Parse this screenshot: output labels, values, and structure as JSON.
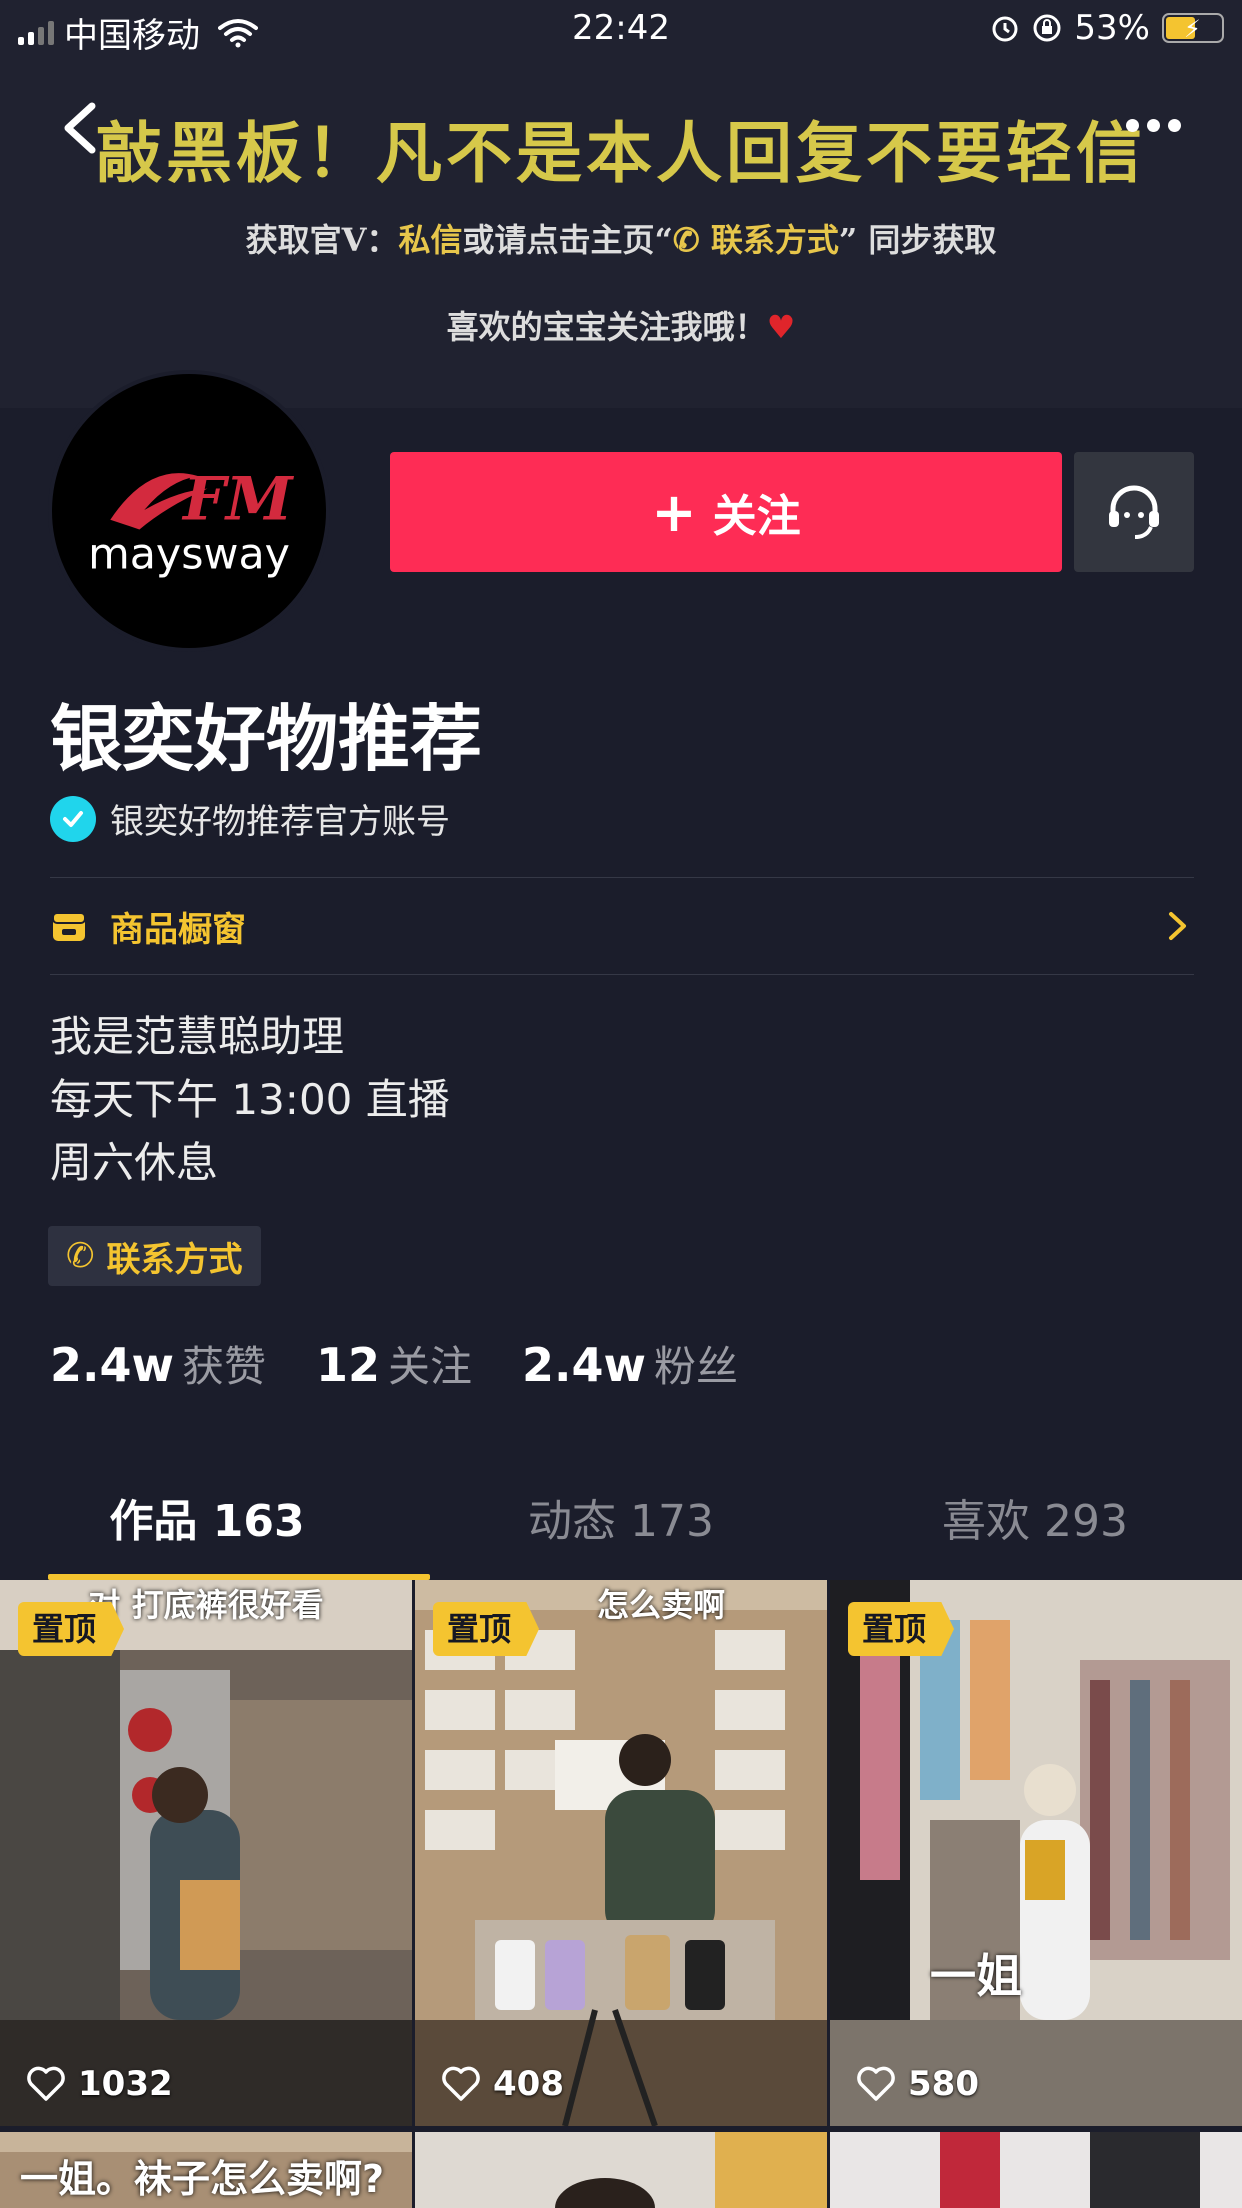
{
  "status_bar": {
    "carrier": "中国移动",
    "time": "22:42",
    "battery": "53%",
    "battery_level": 0.53
  },
  "banner": {
    "title": "敲黑板！凡不是本人回复不要轻信",
    "line2_prefix": "获取官V：",
    "line2_hl1": "私信",
    "line2_mid": "或请点击主页“",
    "line2_hl2": "联系方式",
    "line2_suffix": "” 同步获取",
    "line3": "喜欢的宝宝关注我哦！"
  },
  "profile": {
    "avatar_text": "maysway",
    "avatar_monogram": "FM",
    "follow_label": "关注",
    "name": "银奕好物推荐",
    "verified_label": "银奕好物推荐官方账号",
    "shop_label": "商品橱窗",
    "bio": [
      "我是范慧聪助理",
      "每天下午 13:00 直播",
      "周六休息"
    ],
    "contact_label": "联系方式"
  },
  "stats": [
    {
      "num": "2.4w",
      "label": "获赞"
    },
    {
      "num": "12",
      "label": "关注"
    },
    {
      "num": "2.4w",
      "label": "粉丝"
    }
  ],
  "tabs": [
    {
      "label": "作品 163"
    },
    {
      "label": "动态 173"
    },
    {
      "label": "喜欢 293"
    }
  ],
  "videos": [
    {
      "pin": "置顶",
      "likes": "1032",
      "caption": "对 打底裤很好看"
    },
    {
      "pin": "置顶",
      "likes": "408",
      "caption": "怎么卖啊"
    },
    {
      "pin": "置顶",
      "likes": "580",
      "caption": "一姐"
    }
  ],
  "row2_captions": [
    "一姐。袜子怎么卖啊?"
  ],
  "colors": {
    "accent": "#fe2c55",
    "gold": "#f4c430",
    "verify": "#20d5ec",
    "background": "#1b1d2b"
  }
}
